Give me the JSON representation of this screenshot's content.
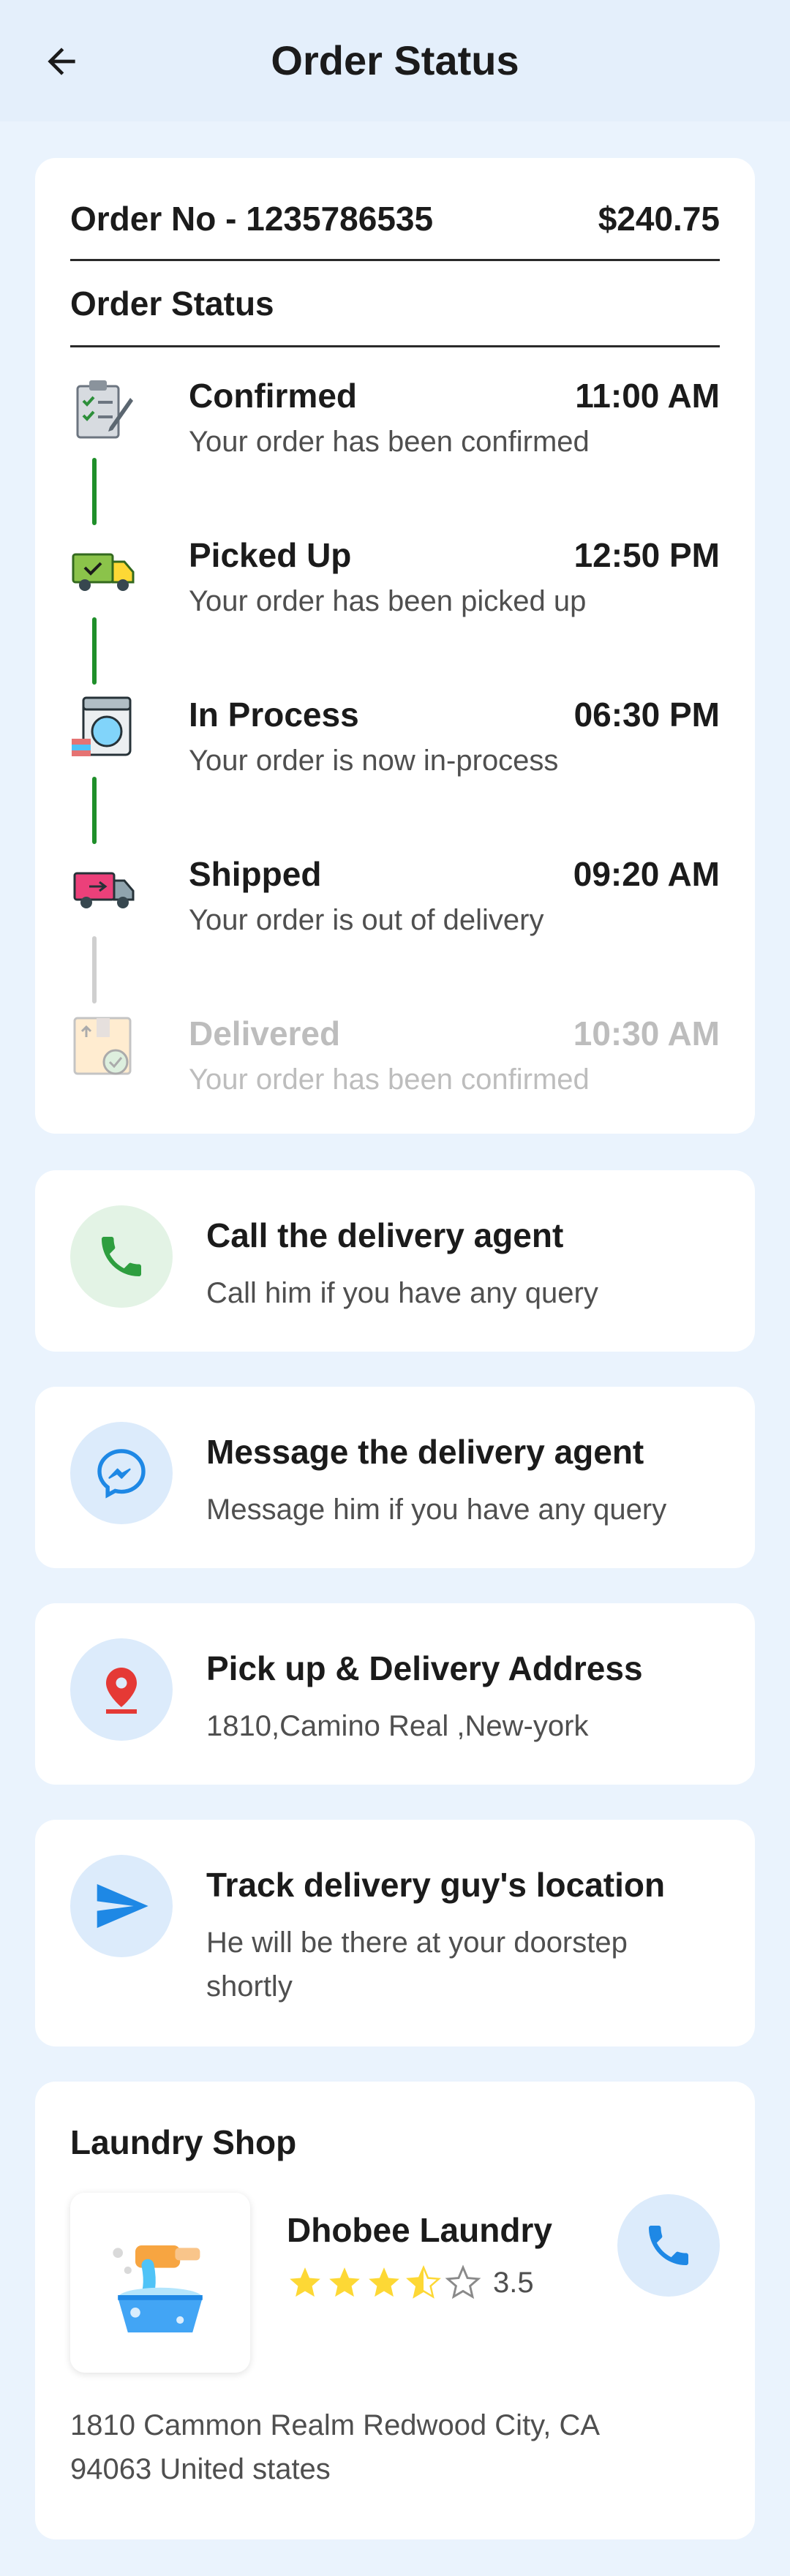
{
  "header": {
    "title": "Order Status",
    "back_icon": "arrow-left-icon"
  },
  "order": {
    "number_label": "Order No - 1235786535",
    "total": "$240.75",
    "status_heading": "Order Status",
    "steps": [
      {
        "title": "Confirmed",
        "time": "11:00 AM",
        "description": "Your order has been confirmed",
        "icon": "clipboard-check-icon",
        "done": true
      },
      {
        "title": "Picked Up",
        "time": "12:50 PM",
        "description": "Your order has been picked up",
        "icon": "truck-check-icon",
        "done": true
      },
      {
        "title": "In Process",
        "time": "06:30 PM",
        "description": "Your order is now in-process",
        "icon": "washing-machine-icon",
        "done": true
      },
      {
        "title": "Shipped",
        "time": "09:20 AM",
        "description": "Your order is out of delivery",
        "icon": "delivery-truck-icon",
        "done": true
      },
      {
        "title": "Delivered",
        "time": "10:30 AM",
        "description": "Your order has been confirmed",
        "icon": "package-delivered-icon",
        "done": false
      }
    ]
  },
  "actions": [
    {
      "title": "Call the delivery agent",
      "subtitle": "Call him if you have any query",
      "icon": "phone-icon"
    },
    {
      "title": "Message the delivery agent",
      "subtitle": "Message him if you have any query",
      "icon": "messenger-icon"
    },
    {
      "title": "Pick up & Delivery Address",
      "subtitle": "1810,Camino Real ,New-york",
      "icon": "location-pin-icon"
    },
    {
      "title": "Track delivery guy's location",
      "subtitle": "He will be there at your doorstep shortly",
      "icon": "send-arrow-icon"
    }
  ],
  "shop": {
    "heading": "Laundry Shop",
    "name": "Dhobee Laundry",
    "rating": "3.5",
    "rating_value": 3.5,
    "rating_max": 5,
    "address": "1810 Cammon Realm Redwood City, CA 94063 United states"
  },
  "colors": {
    "background": "#EAF3FD",
    "done_connector": "#1f8f2a",
    "pending_connector": "#cfcfcf",
    "phone_green": "#2E9E3F",
    "accent_blue": "#1E88E5",
    "pin_red": "#E53935",
    "star_yellow": "#FDD835"
  }
}
